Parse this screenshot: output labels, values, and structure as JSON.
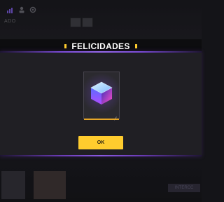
{
  "dialog": {
    "title": "FELICIDADES",
    "ok_label": "OK",
    "reward": {
      "icon": "cube-icon",
      "accent_color": "#e6a628"
    },
    "border_color": "#6a3bb5",
    "button_color": "#ffcc2e"
  },
  "background": {
    "top_title": "ADO",
    "status_icons": [
      "signal-icon",
      "profile-icon",
      "settings-icon"
    ],
    "right_button_label": "INTERCC"
  }
}
